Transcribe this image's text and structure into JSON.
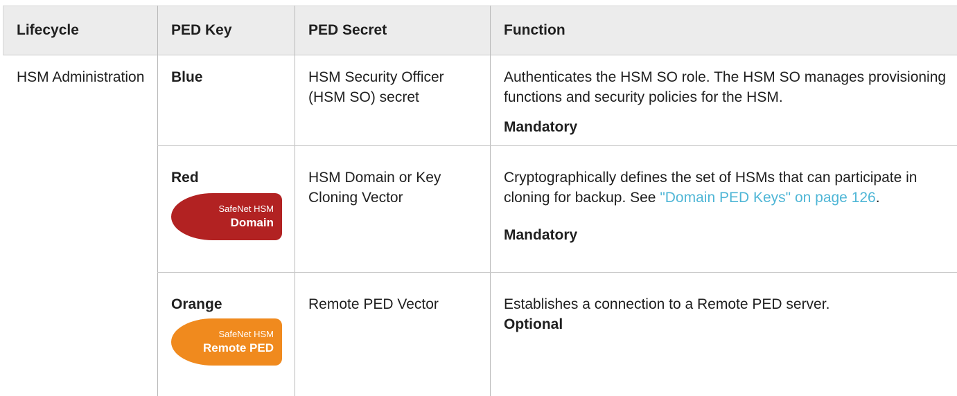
{
  "headers": [
    "Lifecycle",
    "PED Key",
    "PED Secret",
    "Function"
  ],
  "lifecycle": "HSM Administration",
  "rows": [
    {
      "key": "Blue",
      "secret": "HSM Security Officer (HSM SO) secret",
      "function_text": "Authenticates the HSM SO role. The HSM SO manages provisioning functions and security policies for the HSM.",
      "requirement": "Mandatory"
    },
    {
      "key": "Red",
      "tag_brand": "SafeNet HSM",
      "tag_label": "Domain",
      "tag_color": "#b22222",
      "secret": "HSM Domain or Key Cloning Vector",
      "function_text": "Cryptographically defines the set of HSMs that can participate in cloning for backup. See ",
      "link_text": "\"Domain PED Keys\" on page 126",
      "function_suffix": ".",
      "requirement": "Mandatory"
    },
    {
      "key": "Orange",
      "tag_brand": "SafeNet HSM",
      "tag_label": "Remote PED",
      "tag_color": "#f08a1e",
      "secret": "Remote PED Vector",
      "function_text": "Establishes a connection to a Remote PED server.",
      "requirement": "Optional"
    }
  ]
}
